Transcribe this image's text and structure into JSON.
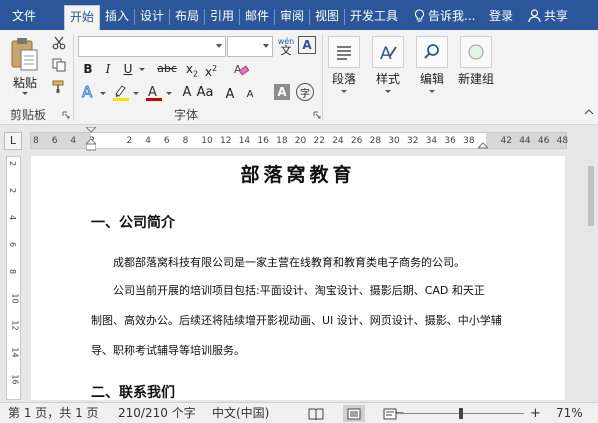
{
  "tabs": [
    "文件",
    "开始",
    "插入",
    "设计",
    "布局",
    "引用",
    "邮件",
    "审阅",
    "视图",
    "开发工具"
  ],
  "active_tab": "开始",
  "tell_me": "告诉我...",
  "login": "登录",
  "share": "共享",
  "ribbon": {
    "clipboard": {
      "paste": "粘贴",
      "group": "剪贴板"
    },
    "font": {
      "group": "字体",
      "bold": "B",
      "italic": "I",
      "underline": "U",
      "strike": "abc",
      "subscript_base": "x",
      "subscript": "2",
      "superscript_base": "x",
      "superscript": "2",
      "font_size_up": "A",
      "font_size_down": "A",
      "aa": "Aa",
      "char_shading": "A",
      "phonetic": "wén",
      "phonetic_char": "文",
      "enclosed": "字",
      "font_color": "#d00000",
      "highlight_color": "#f5e400"
    },
    "paragraph": {
      "label": "段落"
    },
    "styles": {
      "label": "样式"
    },
    "editing": {
      "label": "编辑"
    },
    "new_group": {
      "label": "新建组"
    }
  },
  "ruler": {
    "corner": "L",
    "ticks": [
      "8",
      "6",
      "4",
      "2",
      "",
      "2",
      "4",
      "6",
      "8",
      "10",
      "12",
      "14",
      "16",
      "18",
      "20",
      "22",
      "24",
      "26",
      "28",
      "30",
      "32",
      "34",
      "36",
      "38",
      "",
      "42",
      "44",
      "46",
      "48"
    ],
    "vticks": [
      "2",
      "2",
      "4",
      "6",
      "8",
      "10",
      "12",
      "14",
      "16"
    ]
  },
  "document": {
    "title": "部落窝教育",
    "heading1": "一、公司简介",
    "p1": "成都部落窝科技有限公司是一家主营在线教育和教育类电子商务的公司。",
    "p2_line1": "公司当前开展的培训项目包括:平面设计、淘宝设计、摄影后期、CAD  和天正",
    "p2_line2": "制图、高效办公。后续还将陆续增开影视动画、UI  设计、网页设计、摄影、中小学辅",
    "p2_line3": "导、职称考试辅导等培训服务。",
    "heading2": "二、联系我们"
  },
  "status": {
    "page": "第 1 页，共 1 页",
    "words": "210/210 个字",
    "lang": "中文(中国)",
    "zoom": "71%",
    "zoom_minus": "−",
    "zoom_plus": "+"
  }
}
